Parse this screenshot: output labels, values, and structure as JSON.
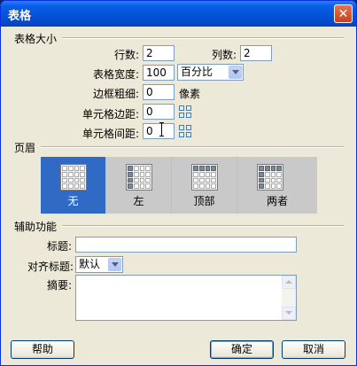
{
  "window": {
    "title": "表格"
  },
  "size_group": {
    "label": "表格大小",
    "rows_label": "行数:",
    "rows_value": "2",
    "cols_label": "列数:",
    "cols_value": "2",
    "width_label": "表格宽度:",
    "width_value": "100",
    "width_unit": "百分比",
    "border_label": "边框粗细:",
    "border_value": "0",
    "border_unit": "像素",
    "padding_label": "单元格边距:",
    "padding_value": "0",
    "spacing_label": "单元格间距:",
    "spacing_value": "0"
  },
  "header_group": {
    "label": "页眉",
    "options": [
      {
        "label": "无",
        "icon": "table-no-header-icon",
        "selected": true
      },
      {
        "label": "左",
        "icon": "table-left-header-icon",
        "selected": false
      },
      {
        "label": "顶部",
        "icon": "table-top-header-icon",
        "selected": false
      },
      {
        "label": "两者",
        "icon": "table-both-header-icon",
        "selected": false
      }
    ]
  },
  "accessibility_group": {
    "label": "辅助功能",
    "caption_label": "标题:",
    "caption_value": "",
    "align_caption_label": "对齐标题:",
    "align_caption_value": "默认",
    "summary_label": "摘要:",
    "summary_value": ""
  },
  "buttons": {
    "help": "帮助",
    "ok": "确定",
    "cancel": "取消"
  },
  "colors": {
    "title_bar": "#0453d8",
    "selected_option": "#316ac5",
    "dialog_bg": "#ece9d8",
    "close_button": "#c6421b"
  }
}
